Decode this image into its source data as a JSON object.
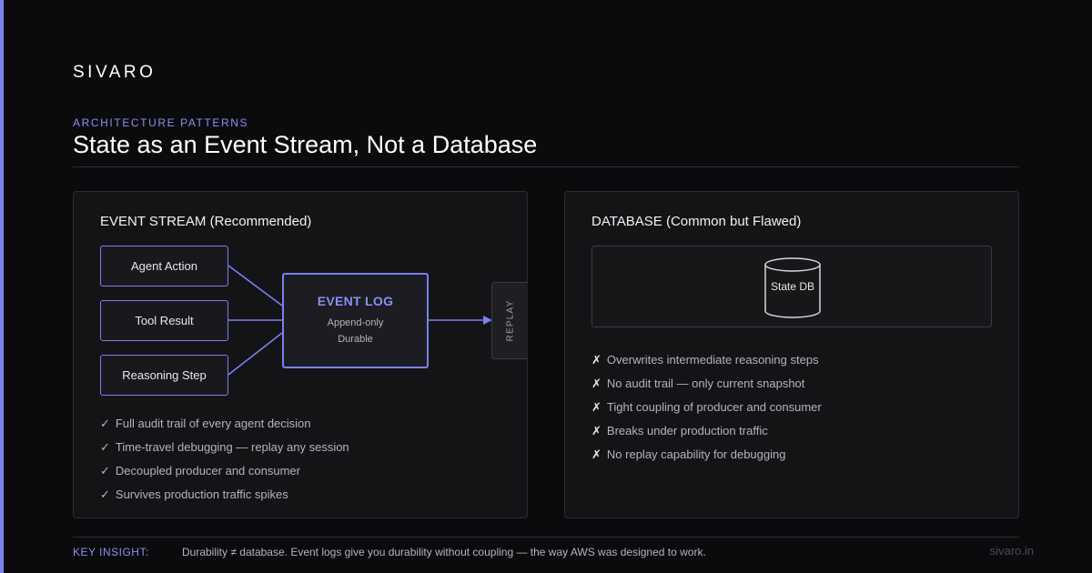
{
  "brand": "SIVARO",
  "eyebrow": "ARCHITECTURE PATTERNS",
  "title": "State as an Event Stream, Not a Database",
  "left_panel": {
    "title": "EVENT STREAM (Recommended)",
    "sources": [
      "Agent Action",
      "Tool Result",
      "Reasoning Step"
    ],
    "event_log": {
      "title": "EVENT LOG",
      "line1": "Append-only",
      "line2": "Durable"
    },
    "replay_label": "REPLAY",
    "check_mark": "✓",
    "benefits": [
      "Full audit trail of every agent decision",
      "Time-travel debugging — replay any session",
      "Decoupled producer and consumer",
      "Survives production traffic spikes"
    ]
  },
  "right_panel": {
    "title": "DATABASE (Common but Flawed)",
    "db_label": "State DB",
    "cross_mark": "✗",
    "drawbacks": [
      "Overwrites intermediate reasoning steps",
      "No audit trail — only current snapshot",
      "Tight coupling of producer and consumer",
      "Breaks under production traffic",
      "No replay capability for debugging"
    ]
  },
  "footer": {
    "insight_label": "KEY INSIGHT:",
    "insight_text": "Durability ≠ database. Event logs give you durability without coupling — the way AWS was designed to work.",
    "site": "sivaro.in"
  },
  "colors": {
    "accent": "#7b7ff0",
    "background": "#0b0b0d",
    "panel": "#141417"
  }
}
